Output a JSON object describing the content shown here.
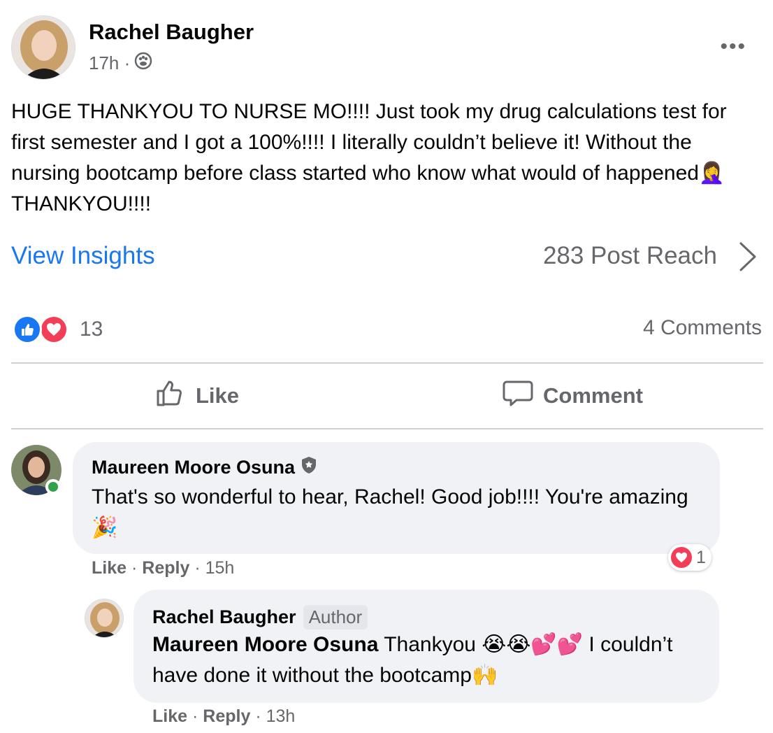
{
  "post": {
    "author": "Rachel Baugher",
    "time": "17h ·",
    "audience_icon": "friends-icon",
    "text": "HUGE THANKYOU TO NURSE MO!!!! Just took my drug calculations test for first semester and I got a 100%!!!! I literally couldn’t believe it! Without the nursing bootcamp before class started who know what would of happened🤦‍♀️ THANKYOU!!!!",
    "more_label": "•••"
  },
  "insights": {
    "view_label": "View Insights",
    "reach": "283 Post Reach"
  },
  "reactions": {
    "count": "13",
    "comments": "4 Comments"
  },
  "actions": {
    "like": "Like",
    "comment": "Comment"
  },
  "comments": [
    {
      "name": "Maureen Moore Osuna",
      "text": "That's so wonderful to hear, Rachel! Good job!!!! You're amazing 🎉",
      "reaction_count": "1",
      "like": "Like",
      "reply": "Reply",
      "time": "15h"
    },
    {
      "name": "Rachel Baugher",
      "badge": "Author",
      "mention": "Maureen Moore Osuna",
      "text": " Thankyou 😭😭💕💕 I couldn’t have done it without the bootcamp🙌",
      "like": "Like",
      "reply": "Reply",
      "time": "13h"
    }
  ],
  "colors": {
    "link_blue": "#1877f2",
    "secondary_text": "#65676b",
    "bubble_bg": "#f0f2f5",
    "love_red": "#f33e58",
    "online_green": "#31a24c"
  }
}
